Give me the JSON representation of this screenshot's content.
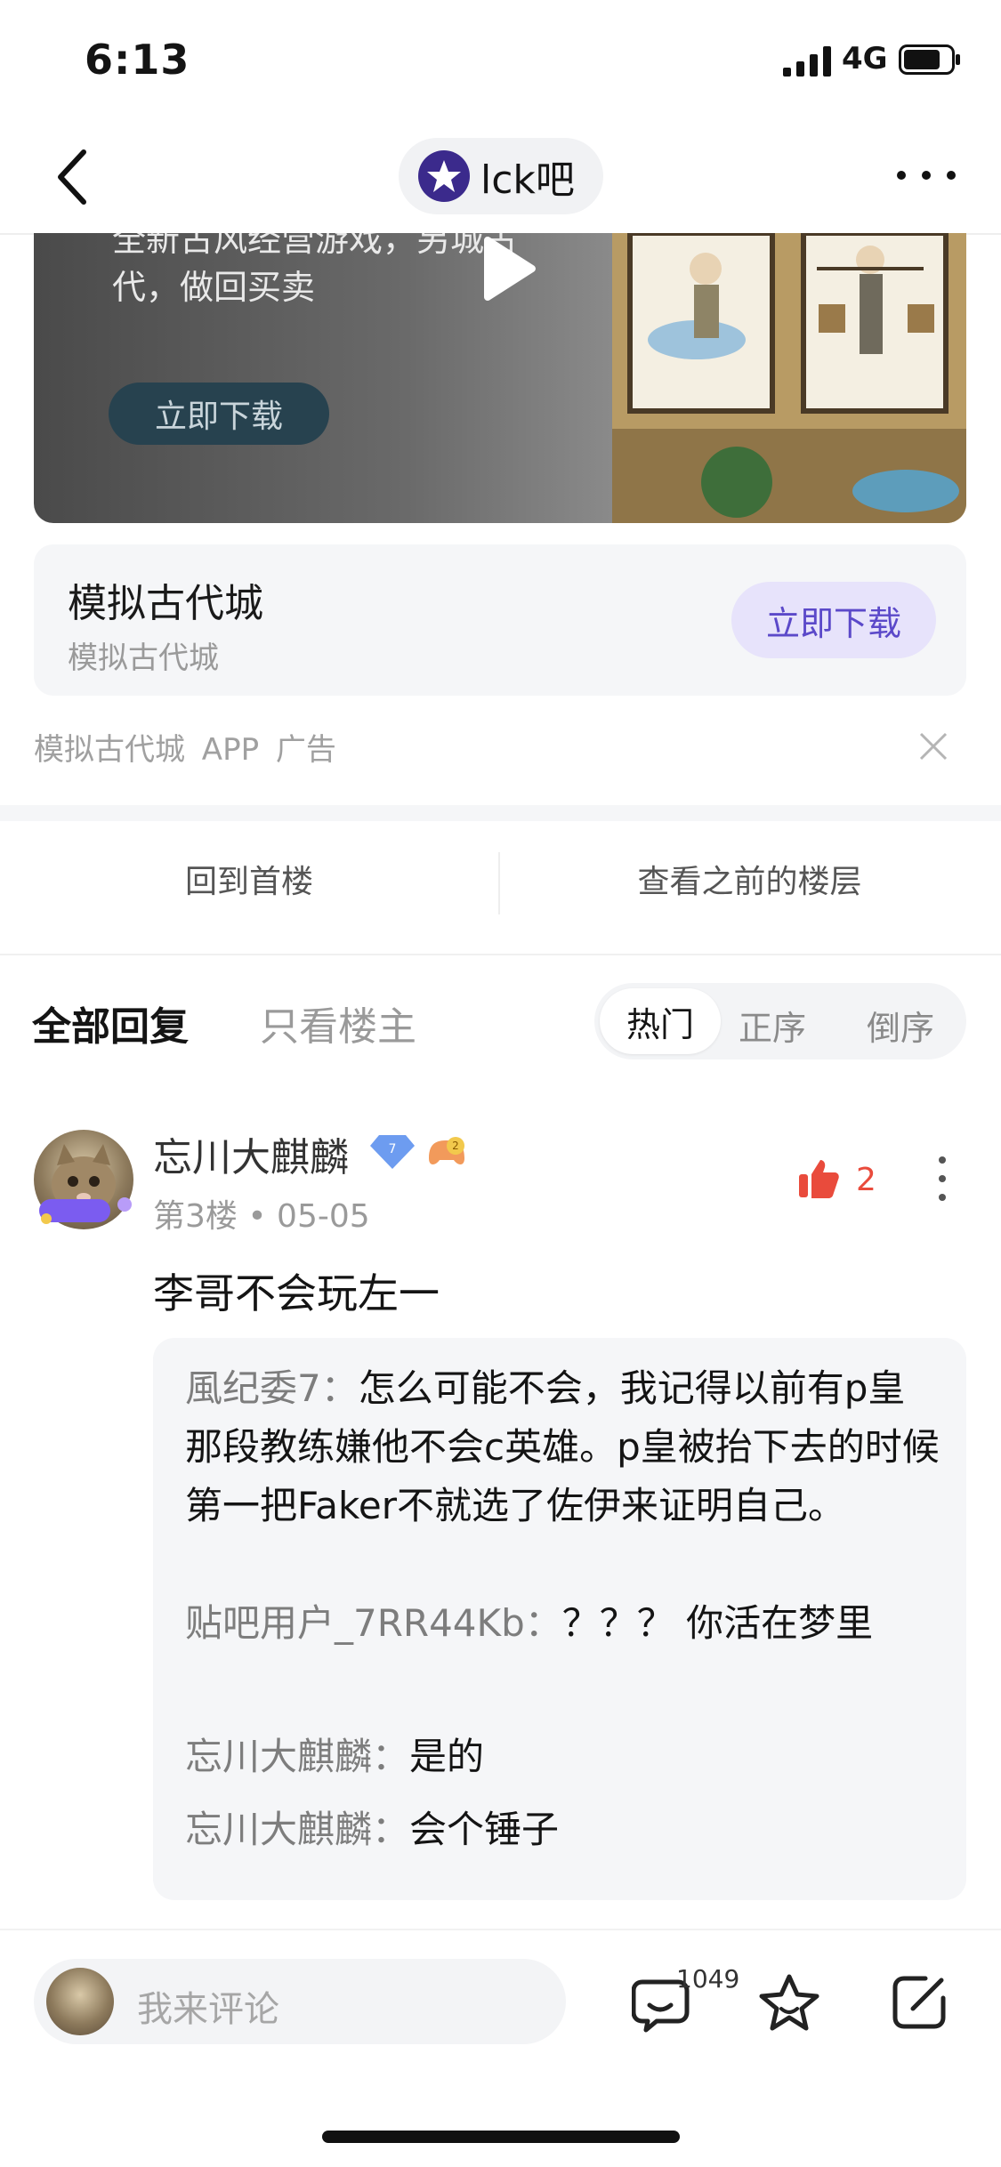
{
  "status_bar": {
    "time": "6:13",
    "network": "4G"
  },
  "nav": {
    "title": "lck吧",
    "logo_icon": "lck-logo-icon",
    "back_icon": "chevron-left-icon",
    "more_icon": "more-horizontal-icon"
  },
  "ad": {
    "video_text": "全新古风经营游戏，另城古代，做回买卖",
    "video_button": "立即下载",
    "app_name": "模拟古代城",
    "app_sub": "模拟古代城",
    "download_label": "立即下载",
    "meta": "模拟古代城  APP  广告",
    "close_icon": "close-icon"
  },
  "floor_nav": {
    "first": "回到首楼",
    "previous": "查看之前的楼层"
  },
  "reply_tabs": {
    "all": "全部回复",
    "host_only": "只看楼主"
  },
  "sort": {
    "hot": "热门",
    "asc": "正序",
    "desc": "倒序"
  },
  "post": {
    "username": "忘川大麒麟",
    "level": "7",
    "game_level": "2",
    "floor": "第3楼",
    "date": "05-05",
    "likes": "2",
    "text": "李哥不会玩左一",
    "replies": [
      {
        "user": "風纪委7",
        "sep": "：",
        "text": "怎么可能不会，我记得以前有p皇那段教练嫌他不会c英雄。p皇被抬下去的时候第一把Faker不就选了佐伊来证明自己。"
      },
      {
        "user": "贴吧用户_7RR44Kb",
        "sep": "：",
        "text": "？？？ 你活在梦里"
      },
      {
        "user": "忘川大麒麟",
        "sep": "：",
        "text": "是的"
      },
      {
        "user": "忘川大麒麟",
        "sep": "：",
        "text": "会个锤子"
      }
    ]
  },
  "bottom_bar": {
    "placeholder": "我来评论",
    "comment_count": "1049"
  },
  "colors": {
    "accent": "#5b49c9",
    "like": "#e94b3c"
  }
}
